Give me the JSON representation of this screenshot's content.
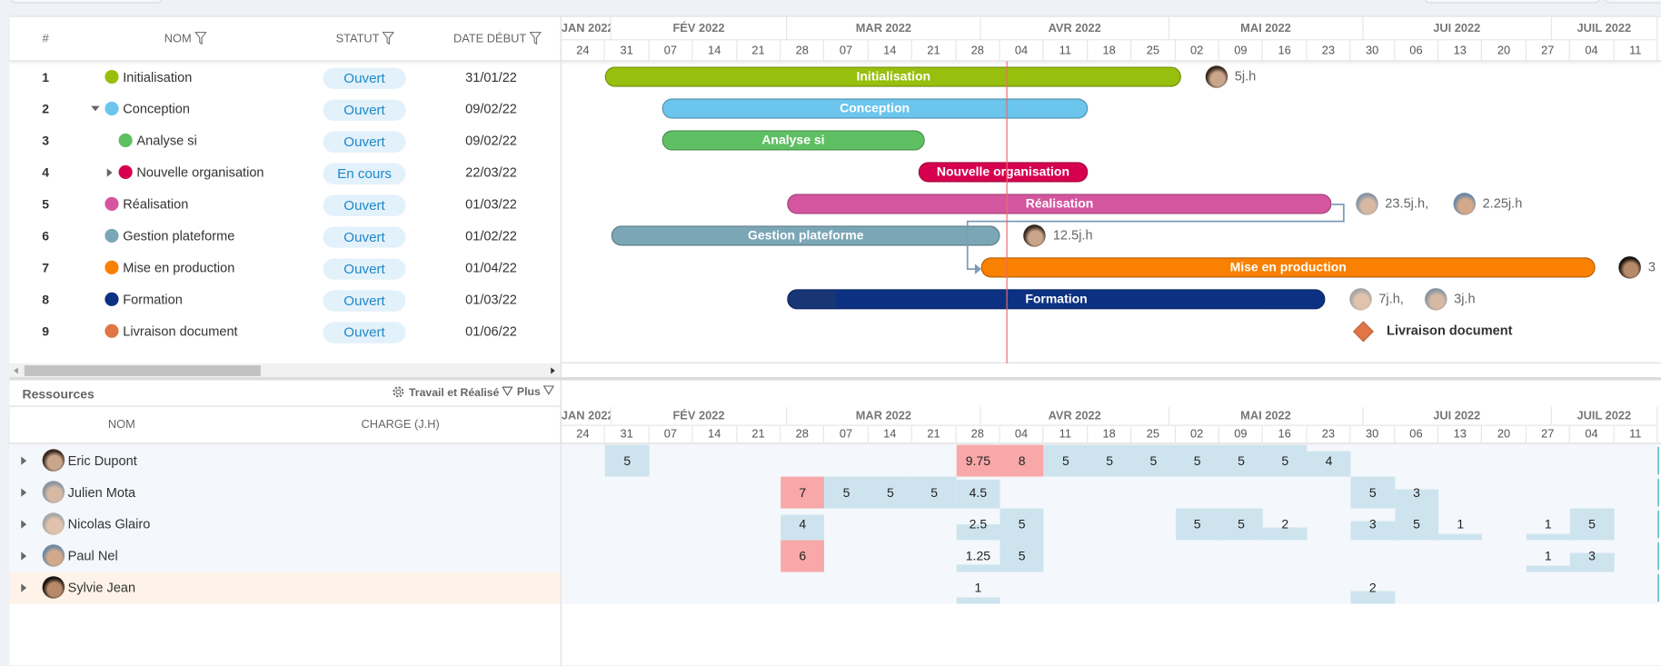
{
  "colors": {
    "accent": "#1e88c8",
    "today_line": "#f06a6a",
    "overload": "#f8a8a8",
    "load": "#cde4ee",
    "dependency": "#7e9cb8"
  },
  "tasks_table": {
    "columns": {
      "num": "#",
      "name": "NOM",
      "status": "STATUT",
      "start": "DATE DÉBUT"
    },
    "rows": [
      {
        "num": "1",
        "name": "Initialisation",
        "status": "Ouvert",
        "start": "31/01/22",
        "color": "#97bf0d",
        "level": 0,
        "expander": "none"
      },
      {
        "num": "2",
        "name": "Conception",
        "status": "Ouvert",
        "start": "09/02/22",
        "color": "#6bc5ec",
        "level": 0,
        "expander": "expanded"
      },
      {
        "num": "3",
        "name": "Analyse si",
        "status": "Ouvert",
        "start": "09/02/22",
        "color": "#5fbf63",
        "level": 1,
        "expander": "none"
      },
      {
        "num": "4",
        "name": "Nouvelle organisation",
        "status": "En cours",
        "start": "22/03/22",
        "color": "#d6004f",
        "level": 1,
        "expander": "collapsed"
      },
      {
        "num": "5",
        "name": "Réalisation",
        "status": "Ouvert",
        "start": "01/03/22",
        "color": "#d4569f",
        "level": 0,
        "expander": "none"
      },
      {
        "num": "6",
        "name": "Gestion plateforme",
        "status": "Ouvert",
        "start": "01/02/22",
        "color": "#7ba6b6",
        "level": 0,
        "expander": "none"
      },
      {
        "num": "7",
        "name": "Mise en production",
        "status": "Ouvert",
        "start": "01/04/22",
        "color": "#f98000",
        "level": 0,
        "expander": "none"
      },
      {
        "num": "8",
        "name": "Formation",
        "status": "Ouvert",
        "start": "01/03/22",
        "color": "#0c3182",
        "level": 0,
        "expander": "none"
      },
      {
        "num": "9",
        "name": "Livraison document",
        "status": "Ouvert",
        "start": "01/06/22",
        "color": "#e07545",
        "level": 0,
        "expander": "none"
      }
    ]
  },
  "timeline": {
    "months": [
      {
        "label": "JAN 2022",
        "start": "2022-01-24",
        "end": "2022-02-01"
      },
      {
        "label": "FÉV 2022",
        "start": "2022-02-01",
        "end": "2022-03-01"
      },
      {
        "label": "MAR 2022",
        "start": "2022-03-01",
        "end": "2022-04-01"
      },
      {
        "label": "AVR 2022",
        "start": "2022-04-01",
        "end": "2022-05-01"
      },
      {
        "label": "MAI 2022",
        "start": "2022-05-01",
        "end": "2022-06-01"
      },
      {
        "label": "JUI 2022",
        "start": "2022-06-01",
        "end": "2022-07-01"
      },
      {
        "label": "JUIL 2022",
        "start": "2022-07-01",
        "end": "2022-07-18"
      }
    ],
    "weeks": [
      "24",
      "31",
      "07",
      "14",
      "21",
      "28",
      "07",
      "14",
      "21",
      "28",
      "04",
      "11",
      "18",
      "25",
      "02",
      "09",
      "16",
      "23",
      "30",
      "06",
      "13",
      "20",
      "27",
      "04",
      "11"
    ],
    "start_date": "2022-01-24",
    "today": "2022-04-05"
  },
  "gantt_bars": [
    {
      "label": "Initialisation",
      "start": "2022-01-31",
      "end": "2022-05-03",
      "color": "#97bf0d",
      "resources": [
        {
          "avatar": "eric",
          "label": "5j.h"
        }
      ]
    },
    {
      "label": "Conception",
      "start": "2022-02-09",
      "end": "2022-04-18",
      "color": "#6bc5ec",
      "resources": []
    },
    {
      "label": "Analyse si",
      "start": "2022-02-09",
      "end": "2022-03-23",
      "color": "#5fbf63",
      "resources": []
    },
    {
      "label": "Nouvelle organisation",
      "start": "2022-03-22",
      "end": "2022-04-18",
      "color": "#d6004f",
      "resources": []
    },
    {
      "label": "Réalisation",
      "start": "2022-03-01",
      "end": "2022-05-27",
      "color": "#d4569f",
      "resources": [
        {
          "avatar": "julien",
          "label": "23.5j.h,"
        },
        {
          "avatar": "paul",
          "label": "2.25j.h"
        }
      ]
    },
    {
      "label": "Gestion plateforme",
      "start": "2022-02-01",
      "end": "2022-04-04",
      "color": "#7ba6b6",
      "resources": [
        {
          "avatar": "eric",
          "label": "12.5j.h"
        }
      ]
    },
    {
      "label": "Mise en production",
      "start": "2022-04-01",
      "end": "2022-07-08",
      "color": "#f98000",
      "resources": [
        {
          "avatar": "sylvie",
          "label": "3"
        }
      ]
    },
    {
      "label": "Formation",
      "start": "2022-03-01",
      "end": "2022-05-26",
      "color": "#0c3182",
      "progress": 0.09,
      "resources": [
        {
          "avatar": "nicolas",
          "label": "7j.h,"
        },
        {
          "avatar": "julien",
          "label": "3j.h"
        }
      ]
    },
    {
      "label": "Livraison document",
      "milestone": true,
      "start": "2022-06-01",
      "color": "#e07545",
      "resources": []
    }
  ],
  "resources_panel": {
    "title": "Ressources",
    "view_label": "Travail et Réalisé",
    "more_label": "Plus",
    "columns": {
      "name": "NOM",
      "charge": "CHARGE (J.H)"
    },
    "capacity_per_week": 5,
    "rows": [
      {
        "name": "Eric Dupont",
        "avatar": "eric",
        "load": {
          "1": 5,
          "9": 9.75,
          "10": 8,
          "11": 5,
          "12": 5,
          "13": 5,
          "14": 5,
          "15": 5,
          "16": 5,
          "17": 4
        }
      },
      {
        "name": "Julien Mota",
        "avatar": "julien",
        "load": {
          "5": 7,
          "6": 5,
          "7": 5,
          "8": 5,
          "9": 4.5,
          "18": 5,
          "19": 3
        }
      },
      {
        "name": "Nicolas Glairo",
        "avatar": "nicolas",
        "load": {
          "5": 4,
          "9": 2.5,
          "10": 5,
          "14": 5,
          "15": 5,
          "16": 2,
          "18": 3,
          "19": 5,
          "20": 1,
          "22": 1,
          "23": 5
        }
      },
      {
        "name": "Paul Nel",
        "avatar": "paul",
        "load": {
          "5": 6,
          "9": 1.25,
          "10": 5,
          "22": 1,
          "23": 3
        }
      },
      {
        "name": "Sylvie Jean",
        "avatar": "sylvie",
        "selected": true,
        "load": {
          "9": 1,
          "18": 2
        }
      }
    ]
  }
}
